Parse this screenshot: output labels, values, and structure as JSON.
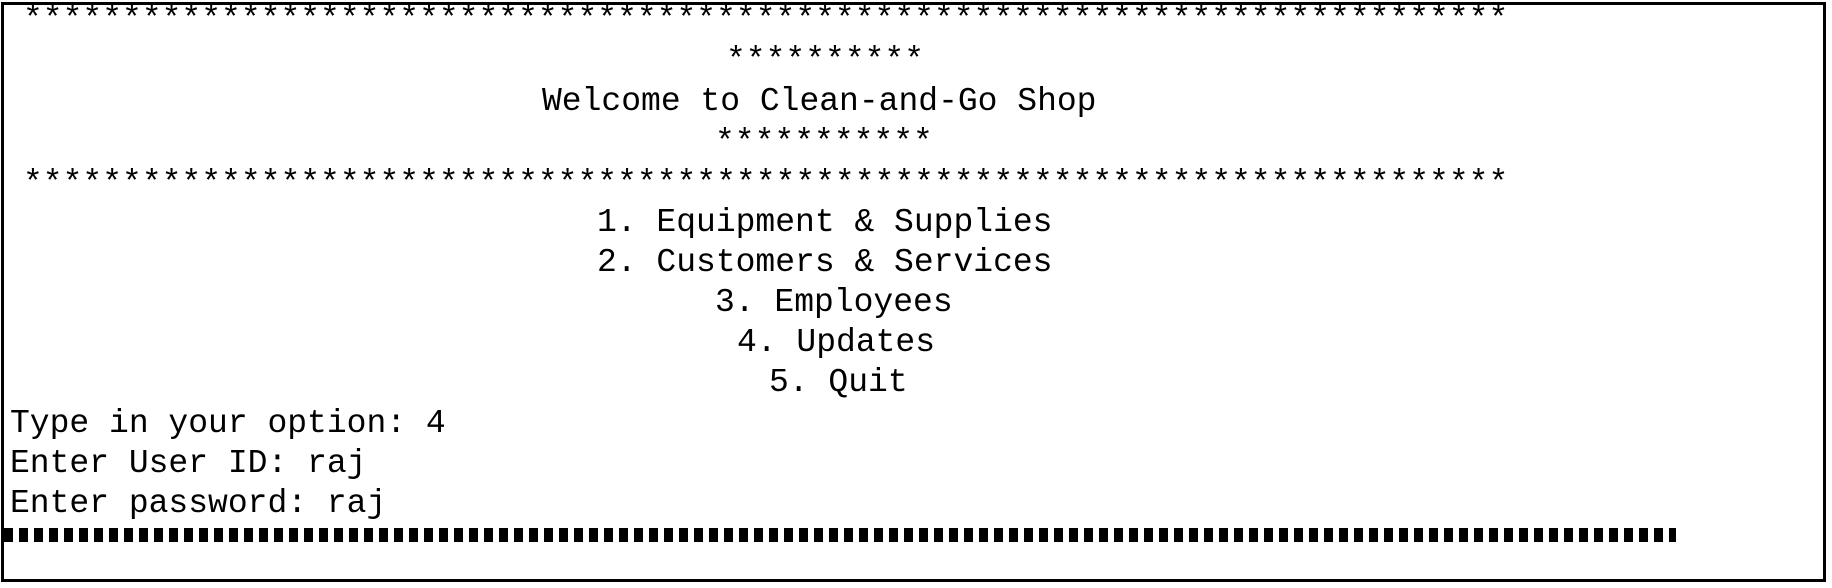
{
  "header": {
    "top_rule": "***************************************************************************",
    "small_stars_top": "**********",
    "title": "Welcome to Clean-and-Go Shop",
    "small_stars_bottom": "***********",
    "bottom_rule": "***************************************************************************"
  },
  "menu": {
    "items": [
      {
        "label": "1. Equipment & Supplies"
      },
      {
        "label": "2. Customers & Services"
      },
      {
        "label": "3. Employees"
      },
      {
        "label": "4. Updates"
      },
      {
        "label": "5. Quit"
      }
    ]
  },
  "prompts": {
    "option": {
      "label": "Type in your option: ",
      "value": "4"
    },
    "user_id": {
      "label": "Enter User ID: ",
      "value": "raj"
    },
    "password": {
      "label": "Enter password: ",
      "value": "raj"
    }
  },
  "colors": {
    "text": "#000000",
    "background": "#ffffff"
  }
}
